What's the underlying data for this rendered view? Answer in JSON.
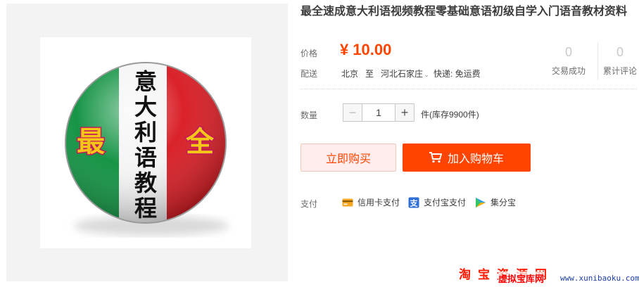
{
  "product": {
    "title": "最全速成意大利语视频教程零基础意语初级自学入门语音教材资料",
    "image": {
      "badge_text": "意大利语教程",
      "left_char": "最",
      "right_char": "全"
    }
  },
  "price": {
    "label": "价格",
    "currency": "¥",
    "value": "10.00",
    "color": "#ff4400"
  },
  "delivery": {
    "label": "配送",
    "from": "北京",
    "to_word": "至",
    "destination": "河北石家庄",
    "shipping": "快递: 免运费"
  },
  "stats": [
    {
      "value": "0",
      "label": "交易成功"
    },
    {
      "value": "0",
      "label": "累计评论"
    }
  ],
  "quantity": {
    "label": "数量",
    "value": "1",
    "minus": "−",
    "plus": "+",
    "stock": "件(库存9900件)"
  },
  "actions": {
    "buy_now": "立即购买",
    "add_to_cart": "加入购物车"
  },
  "payment": {
    "label": "支付",
    "methods": [
      {
        "name": "信用卡支付",
        "icon": "credit-card-icon"
      },
      {
        "name": "支付宝支付",
        "icon": "alipay-icon"
      },
      {
        "name": "集分宝",
        "icon": "jifenbao-icon"
      }
    ]
  },
  "watermark": {
    "line1": "淘宝资源网",
    "brand": "虚拟宝库网",
    "url": "www.xunibaoku.com"
  }
}
